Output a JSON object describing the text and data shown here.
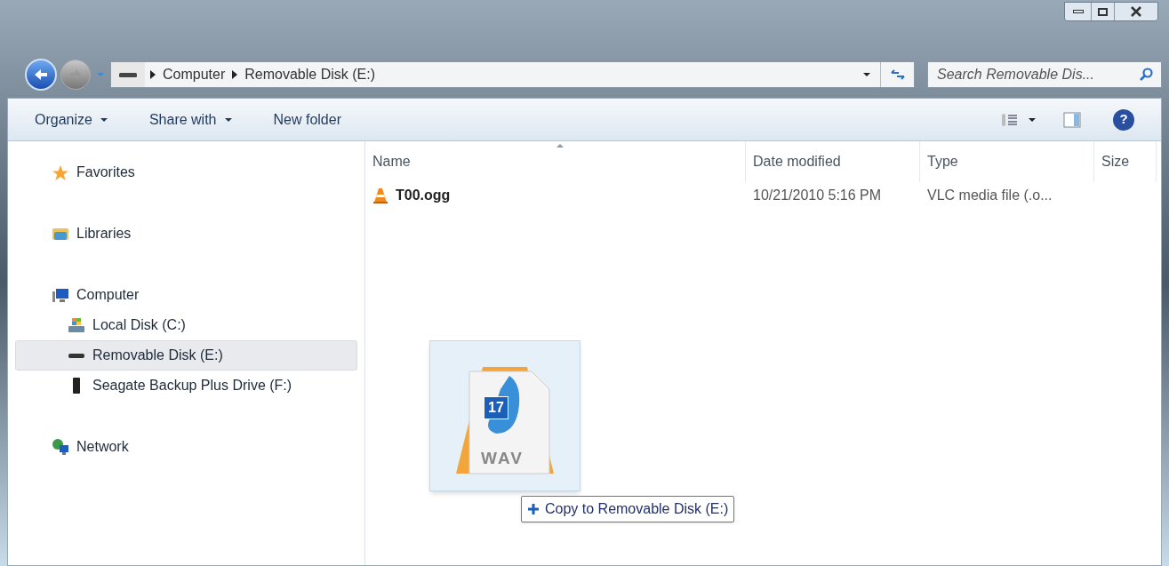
{
  "address_bar": {
    "breadcrumbs": [
      "Computer",
      "Removable Disk (E:)"
    ]
  },
  "search": {
    "placeholder": "Search Removable Dis..."
  },
  "help_button": {
    "label": "?"
  },
  "toolbar": {
    "buttons": [
      {
        "label": "Organize",
        "dropdown": true
      },
      {
        "label": "Share with",
        "dropdown": true
      },
      {
        "label": "New folder",
        "dropdown": false
      }
    ]
  },
  "sidebar": {
    "items": [
      {
        "label": "Favorites",
        "kind": "star",
        "selected": false
      },
      {
        "label": "Libraries",
        "kind": "library",
        "selected": false
      },
      {
        "label": "Computer",
        "kind": "computer",
        "selected": false,
        "children": [
          {
            "label": "Local Disk (C:)",
            "kind": "localdisk",
            "selected": false
          },
          {
            "label": "Removable Disk (E:)",
            "kind": "removable",
            "selected": true
          },
          {
            "label": "Seagate Backup Plus Drive (F:)",
            "kind": "external",
            "selected": false
          }
        ]
      },
      {
        "label": "Network",
        "kind": "network",
        "selected": false
      }
    ]
  },
  "file_list": {
    "columns": [
      {
        "label": "Name",
        "sorted": true
      },
      {
        "label": "Date modified",
        "sorted": false
      },
      {
        "label": "Type",
        "sorted": false
      },
      {
        "label": "Size",
        "sorted": false
      }
    ],
    "rows": [
      {
        "name": "T00.ogg",
        "date_modified": "10/21/2010 5:16 PM",
        "type": "VLC media file (.o..."
      }
    ]
  },
  "drag_ghost": {
    "badge": "17",
    "file_label": "WAV",
    "tooltip": "Copy to Removable Disk (E:)"
  }
}
